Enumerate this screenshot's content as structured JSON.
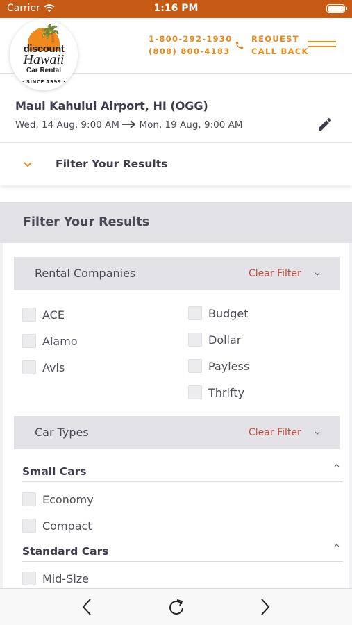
{
  "status_bar": {
    "carrier": "Carrier",
    "time": "1:16 PM"
  },
  "header": {
    "logo": {
      "line1": "discount",
      "line2": "Hawaii",
      "line3": "Car Rental",
      "line4": "· SINCE 1999 ·"
    },
    "phone_primary": "1-800-292-1930",
    "phone_secondary": "(808) 800-4183",
    "callback_line1": "REQUEST",
    "callback_line2": "CALL BACK"
  },
  "trip": {
    "location": "Maui Kahului Airport, HI (OGG)",
    "pickup": "Wed, 14 Aug,  9:00 AM",
    "dropoff": "Mon, 19 Aug,  9:00 AM"
  },
  "filter_toggle": {
    "label": "Filter Your Results"
  },
  "filter_panel": {
    "title": "Filter Your Results",
    "rental_companies": {
      "title": "Rental Companies",
      "clear_label": "Clear Filter",
      "left_options": [
        "ACE",
        "Alamo",
        "Avis"
      ],
      "right_options": [
        "Budget",
        "Dollar",
        "Payless",
        "Thrifty"
      ]
    },
    "car_types": {
      "title": "Car Types",
      "clear_label": "Clear Filter",
      "groups": [
        {
          "title": "Small Cars",
          "options": [
            "Economy",
            "Compact"
          ]
        },
        {
          "title": "Standard Cars",
          "options": [
            "Mid-Size"
          ]
        }
      ]
    }
  },
  "colors": {
    "status_bar": "#c65a15",
    "accent": "#e98a1a",
    "clear_filter": "#c44a3c"
  }
}
